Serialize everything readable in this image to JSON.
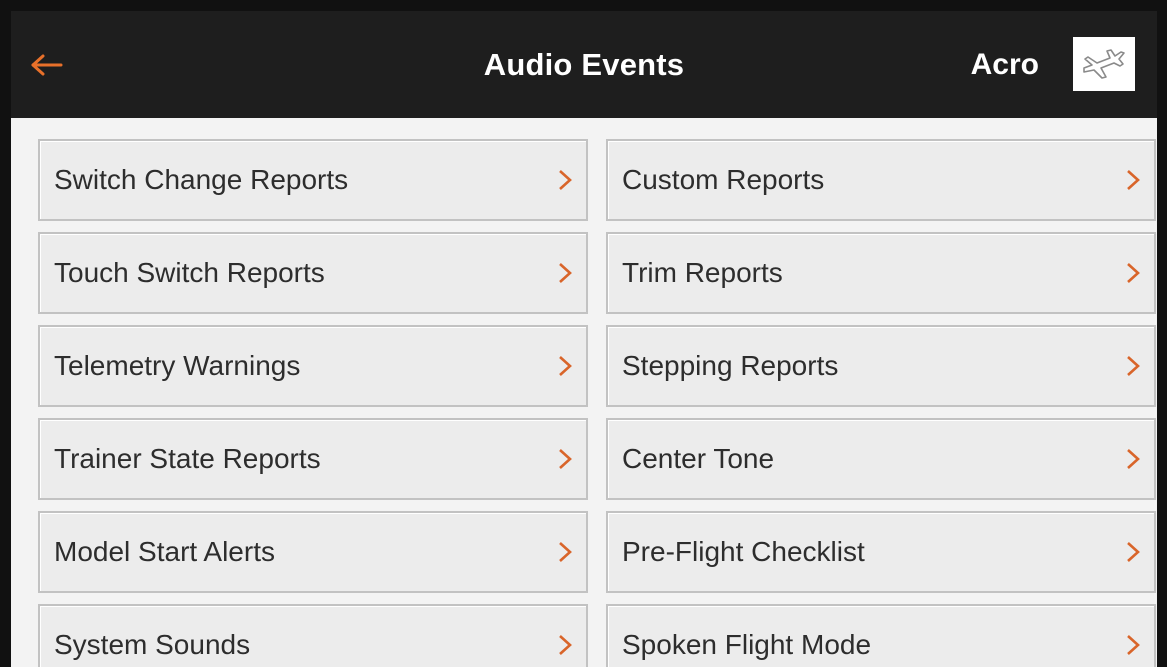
{
  "header": {
    "title": "Audio Events",
    "model_name": "Acro",
    "back_icon": "arrow-left-icon",
    "model_icon": "airplane-icon"
  },
  "colors": {
    "header_bg": "#1e1e1e",
    "accent": "#e8702a",
    "chevron": "#d9652a",
    "item_bg": "#ececec",
    "item_border": "#c2c2c2",
    "text": "#2d2d2d"
  },
  "menu": {
    "left": [
      {
        "label": "Switch Change Reports"
      },
      {
        "label": "Touch Switch Reports"
      },
      {
        "label": "Telemetry Warnings"
      },
      {
        "label": "Trainer State Reports"
      },
      {
        "label": "Model Start Alerts"
      },
      {
        "label": "System Sounds"
      }
    ],
    "right": [
      {
        "label": "Custom Reports"
      },
      {
        "label": "Trim Reports"
      },
      {
        "label": "Stepping Reports"
      },
      {
        "label": "Center Tone"
      },
      {
        "label": "Pre-Flight Checklist"
      },
      {
        "label": "Spoken Flight Mode"
      }
    ]
  }
}
